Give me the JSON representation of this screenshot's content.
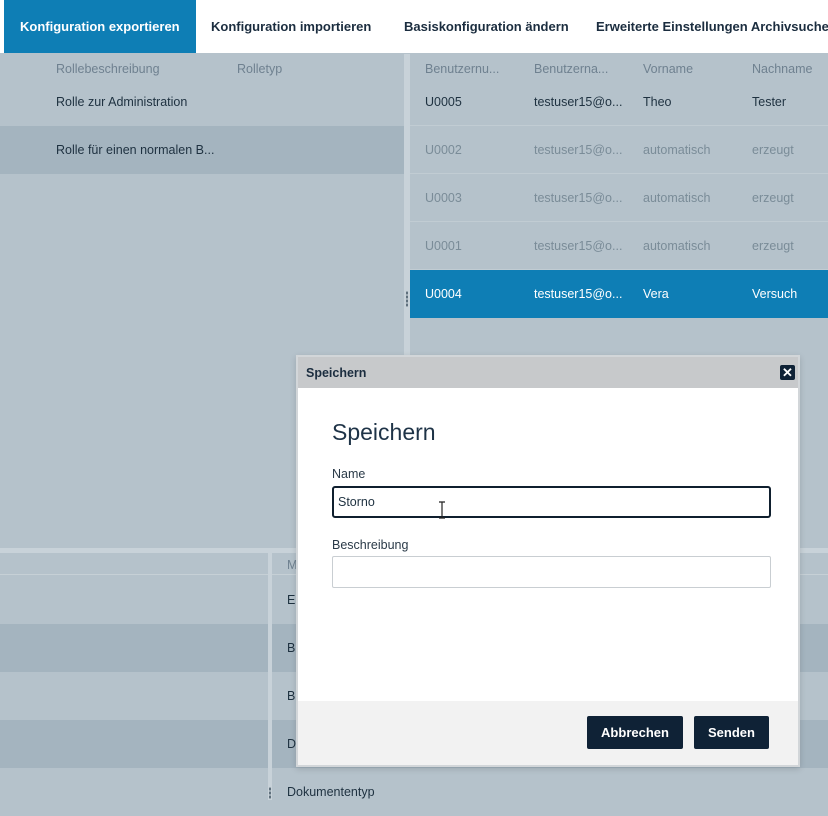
{
  "tabs": [
    {
      "label": "Konfiguration exportieren",
      "active": true
    },
    {
      "label": "Konfiguration importieren",
      "active": false
    },
    {
      "label": "Basiskonfiguration ändern",
      "active": false
    },
    {
      "label": "Erweiterte Einstellungen Archivsuche",
      "active": false
    }
  ],
  "roles": {
    "columns": [
      "Rollebeschreibung",
      "Rolletyp"
    ],
    "rows": [
      {
        "description": "Rolle zur Administration",
        "type": ""
      },
      {
        "description": "Rolle für einen normalen B...",
        "type": ""
      }
    ]
  },
  "users": {
    "columns": [
      "Benutzernu...",
      "Benutzerna...",
      "Vorname",
      "Nachname"
    ],
    "rows": [
      {
        "number": "U0005",
        "name": "testuser15@o...",
        "first": "Theo",
        "last": "Tester",
        "state": "normal"
      },
      {
        "number": "U0002",
        "name": "testuser15@o...",
        "first": "automatisch",
        "last": "erzeugt",
        "state": "dim"
      },
      {
        "number": "U0003",
        "name": "testuser15@o...",
        "first": "automatisch",
        "last": "erzeugt",
        "state": "dim"
      },
      {
        "number": "U0001",
        "name": "testuser15@o...",
        "first": "automatisch",
        "last": "erzeugt",
        "state": "dim"
      },
      {
        "number": "U0004",
        "name": "testuser15@o...",
        "first": "Vera",
        "last": "Versuch",
        "state": "selected"
      }
    ]
  },
  "bottom": {
    "column_header": "M",
    "rows": [
      "Ei",
      "B",
      "B",
      "D",
      "Dokumententyp"
    ]
  },
  "dialog": {
    "window_title": "Speichern",
    "heading": "Speichern",
    "name_label": "Name",
    "name_value": "Storno",
    "description_label": "Beschreibung",
    "description_value": "",
    "cancel_label": "Abbrechen",
    "submit_label": "Senden"
  },
  "colors": {
    "accent": "#0e7eb5",
    "button_dark": "#0f2236",
    "overlay": "#b5c2cb"
  }
}
